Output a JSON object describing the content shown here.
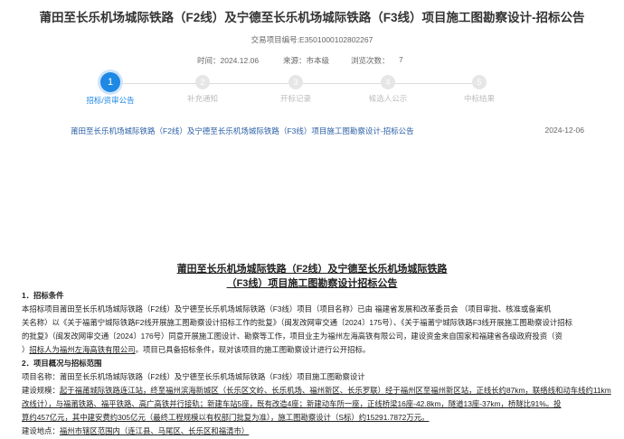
{
  "page": {
    "title": "莆田至长乐机场城际铁路（F2线）及宁德至长乐机场城际铁路（F3线）项目施工图勘察设计-招标公告",
    "project_no": "交易项目编号:E3501000102802267"
  },
  "meta": {
    "time": "时间：2024.12.06",
    "source": "来源：市本级",
    "views_label": "浏览次数：",
    "views_value": "7"
  },
  "steps": [
    {
      "num": "1",
      "label": "招标/资审公告"
    },
    {
      "num": "2",
      "label": "补充通知"
    },
    {
      "num": "3",
      "label": "开标记录"
    },
    {
      "num": "4",
      "label": "候选人公示"
    },
    {
      "num": "5",
      "label": "中标结果"
    }
  ],
  "notice": {
    "link": "莆田至长乐机场城际铁路（F2线）及宁德至长乐机场城际铁路（F3线）项目施工图勘察设计-招标公告",
    "date": "2024-12-06"
  },
  "doc": {
    "title_line1": "莆田至长乐机场城际铁路（F2线）及宁德至长乐机场城际铁路",
    "title_line2": "（F3线）项目施工图勘察设计招标公告",
    "s1_head": "1．招标条件",
    "s1_l1": "本招标项目莆田至长乐机场城际铁路（F2线）及宁德至长乐机场城际铁路（F3线）项目（项目名称）已由 福建省发展和改革委员会 （项目审批、核准或备案机",
    "s1_l2": "关名称）以《关于福莆宁城际铁路F2线开展施工图勘察设计招标工作的批复》（闽发改网审交通〔2024〕175号）、《关于福莆宁城际铁路F3线开展施工图勘察设计招标",
    "s1_l3": "的批复》（闽发改网审交通〔2024〕176号）同意开展施工图设计、勘察等工作，项目业主为福州左海高铁有限公司，建设资金来自国家和福建省各级政府投资（资",
    "s1_l4": "）",
    "s1_l4_owner": "招标人为福州左海高铁有限公司",
    "s1_l4_rest": "。项目已具备招标条件，现对该项目的施工图勘察设计进行公开招标。",
    "s2_head": "2．项目概况与招标范围",
    "s2_name": "项目名称：莆田至长乐机场城际铁路（F2线）及宁德至长乐机场城际铁路（F3线）项目施工图勘察设计",
    "s2_scale_label": "建设规模：",
    "s2_scale_l1": "起于福莆城际铁路连江站，终至福州滨海新城区（长乐区文岭、长乐机场、福州新区、长乐罗联）经于福州区至福州新区站，正线长约87km，联络线和动车线约11km",
    "s2_scale_l2": "改线计），与福莆铁路、福平铁路、高广高铁并行接轨；新建车站5座，既有改造4座；新建动车所一座，正线桥梁16座-42.8km，隧道13座-37km，桥隧比91%。投",
    "s2_scale_l3": "算约457亿元，其中建安费约305亿元（最终工程规模以有权部门批复为准），施工图勘察设计（S标）约15291.7872万元。",
    "s2_loc_label": "建设地点：",
    "s2_loc": "福州市辖区范围内（连江县、马尾区、长乐区和福清市）"
  }
}
